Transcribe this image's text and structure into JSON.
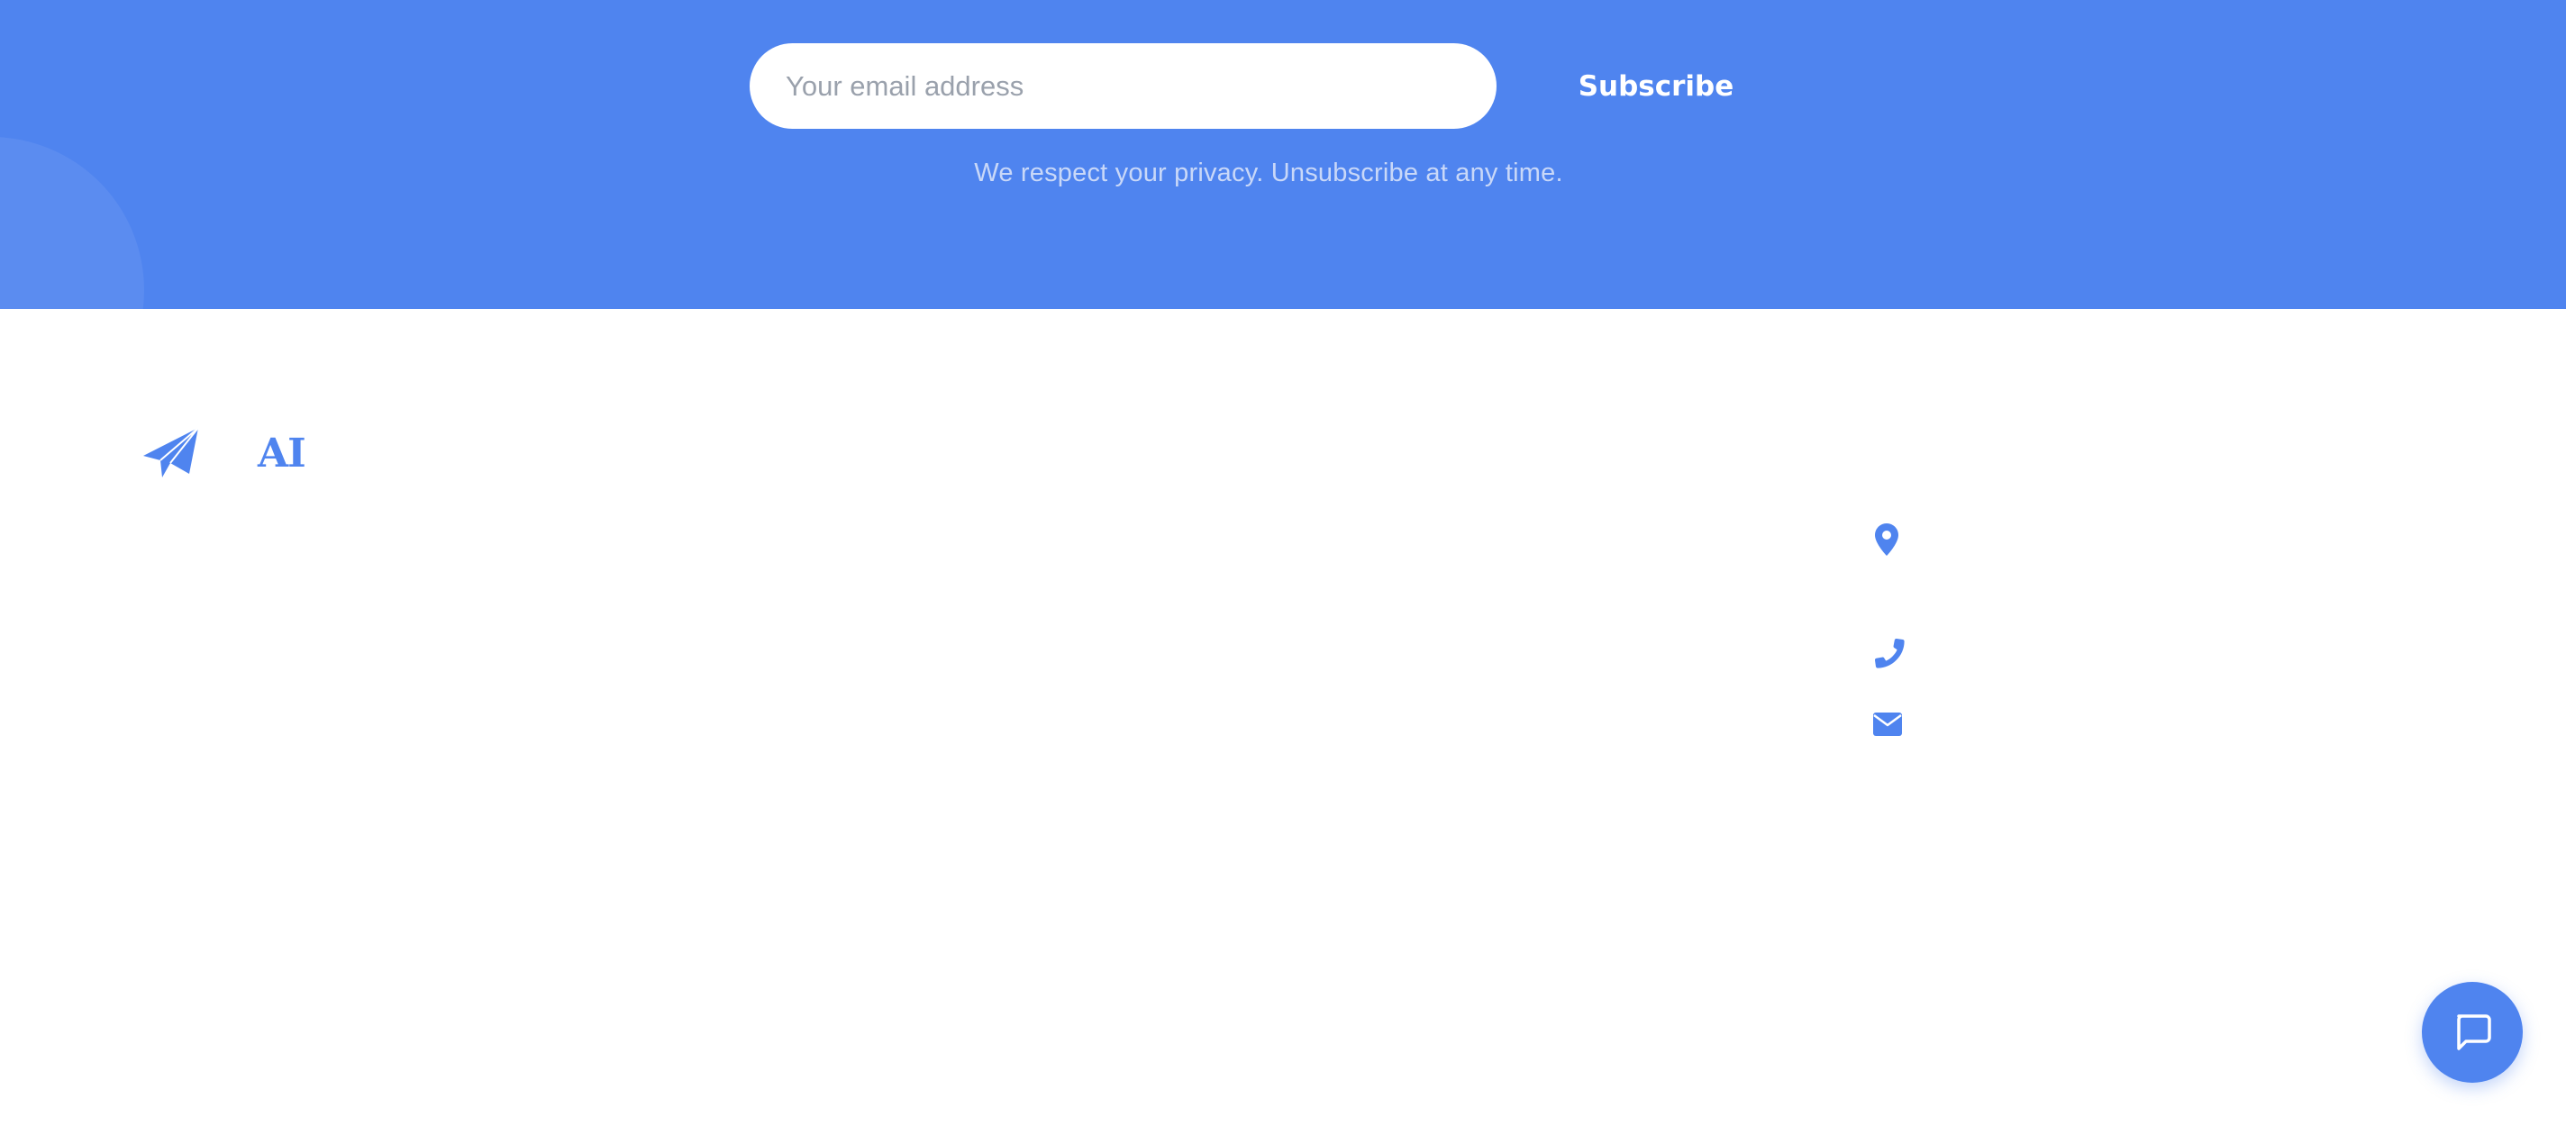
{
  "newsletter": {
    "email_placeholder": "Your email address",
    "subscribe_label": "Subscribe",
    "privacy_note": "We respect your privacy. Unsubscribe at any time."
  },
  "footer": {
    "brand": {
      "icon": "paper-plane-icon",
      "name": "AI"
    },
    "contact_icons": [
      "map-pin-icon",
      "phone-icon",
      "envelope-icon"
    ]
  },
  "chat": {
    "icon": "chat-bubble-icon"
  },
  "colors": {
    "accent": "#4f84ef",
    "background": "#ffffff",
    "privacy_text": "#c9d8f8"
  }
}
